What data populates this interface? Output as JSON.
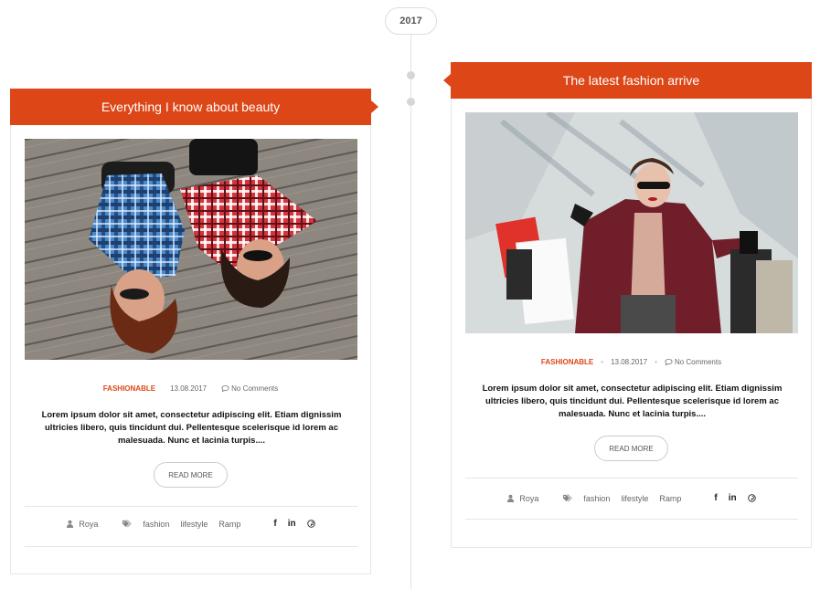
{
  "year": "2017",
  "posts": [
    {
      "title": "Everything I know about beauty",
      "category": "FASHIONABLE",
      "date": "13.08.2017",
      "comments": "No Comments",
      "excerpt": "Lorem ipsum dolor sit amet, consectetur adipiscing elit. Etiam dignissim ultricies libero, quis tincidunt dui. Pellentesque scelerisque id lorem ac malesuada. Nunc et lacinia turpis....",
      "read_more": "READ MORE",
      "author": "Roya",
      "tags": [
        "fashion",
        "lifestyle",
        "Ramp"
      ],
      "social": [
        "f",
        "in",
        "p"
      ]
    },
    {
      "title": "The latest fashion arrive",
      "category": "FASHIONABLE",
      "date": "13.08.2017",
      "comments": "No Comments",
      "excerpt": "Lorem ipsum dolor sit amet, consectetur adipiscing elit. Etiam dignissim ultricies libero, quis tincidunt dui. Pellentesque scelerisque id lorem ac malesuada. Nunc et lacinia turpis....",
      "read_more": "READ MORE",
      "author": "Roya",
      "tags": [
        "fashion",
        "lifestyle",
        "Ramp"
      ],
      "social": [
        "f",
        "in",
        "p"
      ]
    }
  ],
  "colors": {
    "accent": "#dd4718"
  }
}
